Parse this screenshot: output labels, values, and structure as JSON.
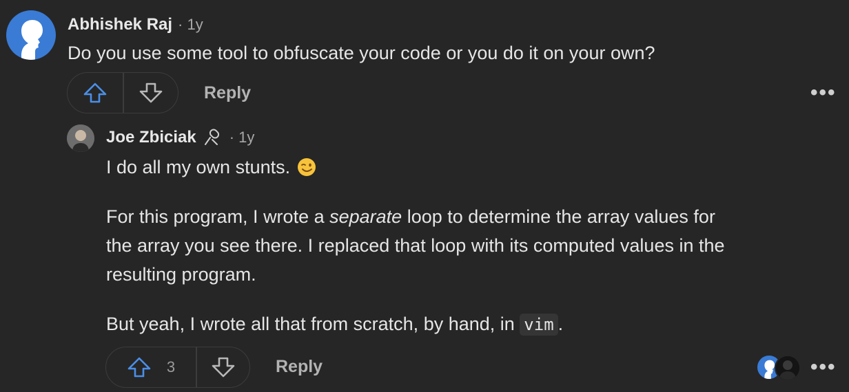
{
  "comment1": {
    "author": "Abhishek Raj",
    "time": "· 1y",
    "text": "Do you use some tool to obfuscate your code or you do it on your own?",
    "reply_label": "Reply",
    "more_label": "•••"
  },
  "comment2": {
    "author": "Joe Zbiciak",
    "time": "· 1y",
    "para1": "I do all my own stunts.",
    "para2_before": "For this program, I wrote a ",
    "para2_em": "separate",
    "para2_line1_after": " loop to determine the array values for",
    "para2_line2": "the array you see there. I replaced that loop with its computed values in the",
    "para2_line3": "resulting program.",
    "para3_before": "But yeah, I wrote all that from scratch, by hand, in ",
    "para3_code": "vim",
    "para3_after": ".",
    "upvote_count": "3",
    "reply_label": "Reply",
    "more_label": "•••"
  },
  "colors": {
    "background": "#262626",
    "accent_blue": "#3a7bd5",
    "border": "#3c3c3c"
  }
}
